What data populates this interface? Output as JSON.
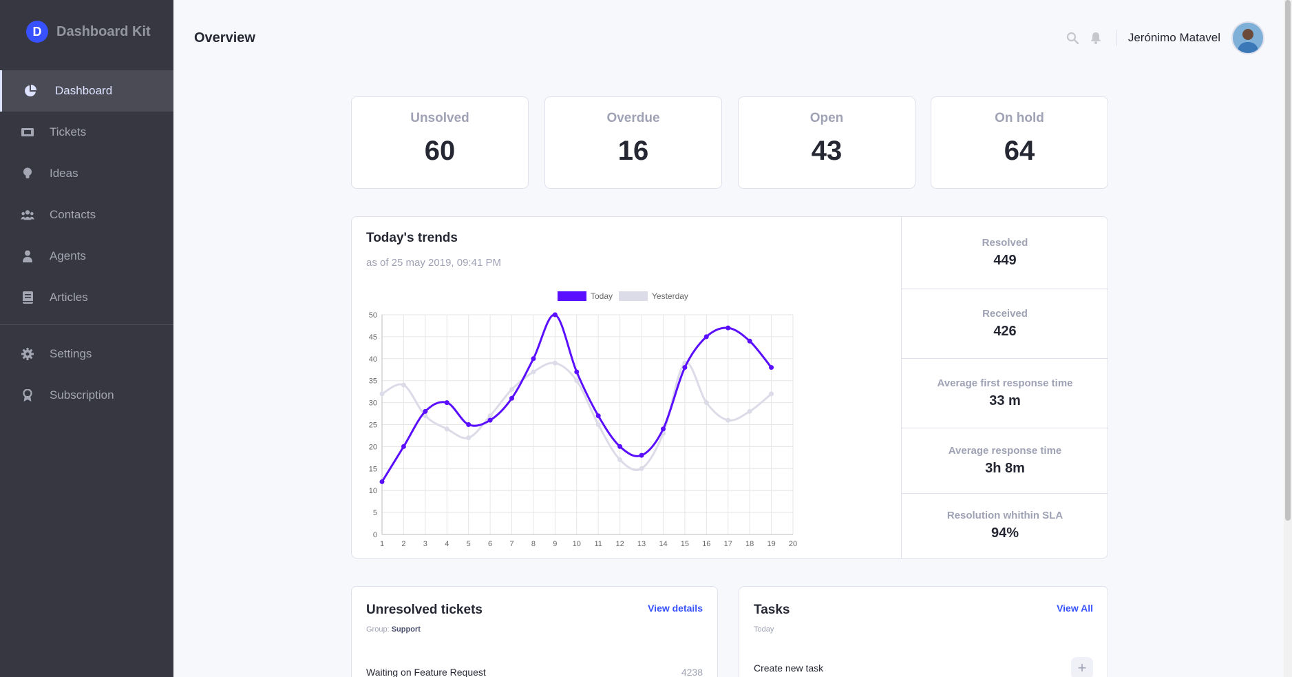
{
  "brand": {
    "name": "Dashboard Kit",
    "logo_letter": "D"
  },
  "nav": {
    "items": [
      {
        "label": "Dashboard",
        "icon": "pie-chart-icon"
      },
      {
        "label": "Tickets",
        "icon": "ticket-icon"
      },
      {
        "label": "Ideas",
        "icon": "lightbulb-icon"
      },
      {
        "label": "Contacts",
        "icon": "users-icon"
      },
      {
        "label": "Agents",
        "icon": "agent-icon"
      },
      {
        "label": "Articles",
        "icon": "book-icon"
      }
    ],
    "secondary": [
      {
        "label": "Settings",
        "icon": "gear-icon"
      },
      {
        "label": "Subscription",
        "icon": "award-icon"
      }
    ]
  },
  "header": {
    "title": "Overview",
    "user_name": "Jerónimo Matavel"
  },
  "kpis": [
    {
      "label": "Unsolved",
      "value": "60"
    },
    {
      "label": "Overdue",
      "value": "16"
    },
    {
      "label": "Open",
      "value": "43"
    },
    {
      "label": "On hold",
      "value": "64"
    }
  ],
  "trends": {
    "title": "Today's trends",
    "subtitle": "as of 25 may 2019, 09:41 PM"
  },
  "stats": [
    {
      "label": "Resolved",
      "value": "449"
    },
    {
      "label": "Received",
      "value": "426"
    },
    {
      "label": "Average first response time",
      "value": "33 m"
    },
    {
      "label": "Average response time",
      "value": "3h 8m"
    },
    {
      "label": "Resolution whithin SLA",
      "value": "94%"
    }
  ],
  "chart_data": {
    "type": "line",
    "x": [
      1,
      2,
      3,
      4,
      5,
      6,
      7,
      8,
      9,
      10,
      11,
      12,
      13,
      14,
      15,
      16,
      17,
      18,
      19,
      20
    ],
    "series": [
      {
        "name": "Today",
        "color": "#5b0fff",
        "values": [
          12,
          20,
          28,
          30,
          25,
          26,
          31,
          40,
          50,
          37,
          27,
          20,
          18,
          24,
          38,
          45,
          47,
          44,
          38
        ]
      },
      {
        "name": "Yesterday",
        "color": "#dcdbe8",
        "values": [
          32,
          34,
          27,
          24,
          22,
          27,
          33,
          37,
          39,
          35,
          25,
          17,
          15,
          23,
          39,
          30,
          26,
          28,
          32
        ]
      }
    ],
    "ylim": [
      0,
      50
    ],
    "yticks": [
      0,
      5,
      10,
      15,
      20,
      25,
      30,
      35,
      40,
      45,
      50
    ],
    "grid": true,
    "legend": "top-center"
  },
  "unresolved": {
    "title": "Unresolved tickets",
    "link": "View details",
    "group_label": "Group:",
    "group_value": "Support",
    "row_label": "Waiting on Feature Request",
    "row_value": "4238"
  },
  "tasks": {
    "title": "Tasks",
    "link": "View All",
    "subtitle": "Today",
    "row_label": "Create new task",
    "add_label": "+"
  }
}
